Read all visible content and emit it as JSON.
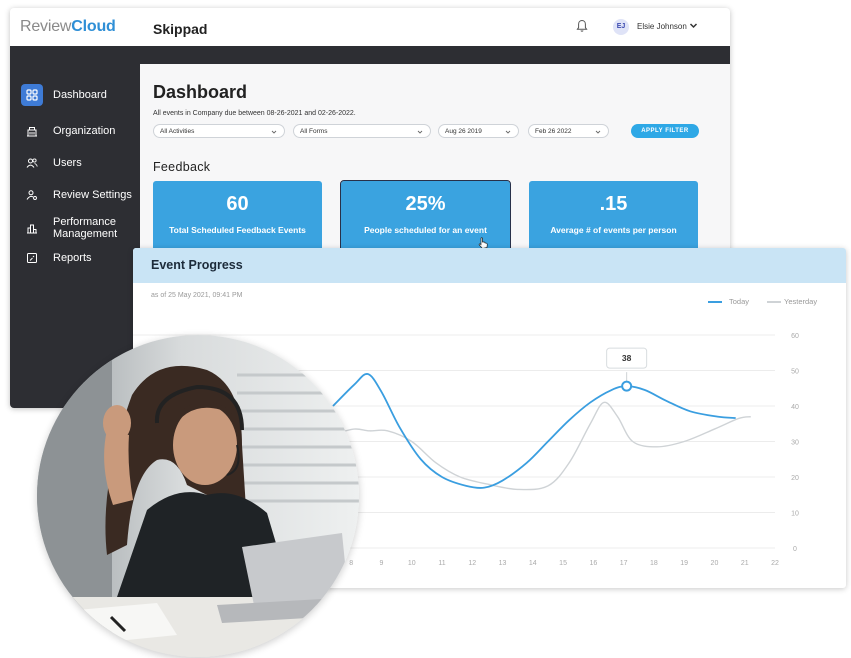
{
  "app": {
    "logo_part1": "Review",
    "logo_part2": "Cloud",
    "title": "Skippad"
  },
  "user": {
    "initials": "EJ",
    "name": "Elsie Johnson"
  },
  "sidebar": {
    "items": [
      {
        "label": "Dashboard",
        "icon": "grid-icon",
        "active": true
      },
      {
        "label": "Organization",
        "icon": "building-icon"
      },
      {
        "label": "Users",
        "icon": "users-icon"
      },
      {
        "label": "Review Settings",
        "icon": "user-settings-icon"
      },
      {
        "label_line1": "Performance",
        "label_line2": "Management",
        "icon": "performance-icon"
      },
      {
        "label": "Reports",
        "icon": "report-icon"
      }
    ]
  },
  "dashboard": {
    "title": "Dashboard",
    "subtitle": "All events in Company due between 08-26-2021 and 02-26-2022.",
    "filters": {
      "activities": "All Activities",
      "forms": "All Forms",
      "date_from": "Aug 26 2019",
      "date_to": "Feb 26 2022",
      "apply_label": "APPLY FILTER"
    },
    "feedback_title": "Feedback",
    "cards": [
      {
        "value": "60",
        "label": "Total Scheduled Feedback Events"
      },
      {
        "value": "25%",
        "label": "People scheduled for an event"
      },
      {
        "value": ".15",
        "label": "Average # of events per person"
      }
    ]
  },
  "event_progress": {
    "title": "Event Progress",
    "as_of": "as of 25 May 2021, 09:41 PM",
    "tooltip": "38"
  },
  "colors": {
    "accent": "#3aa3e0",
    "sidebar": "#2d2e33",
    "today_line": "#3a9ee0",
    "yesterday_line": "#cfd3d6"
  },
  "chart_data": {
    "type": "line",
    "x": [
      8,
      9,
      10,
      11,
      12,
      13,
      14,
      15,
      16,
      17,
      18,
      19,
      20,
      21,
      22
    ],
    "x_tick_labels": [
      "8",
      "9",
      "10",
      "11",
      "12",
      "13",
      "14",
      "15",
      "16",
      "17",
      "18",
      "19",
      "20",
      "21",
      "22"
    ],
    "y_ticks": [
      0,
      10,
      20,
      30,
      40,
      50,
      60
    ],
    "ylim": [
      0,
      60
    ],
    "xlim": [
      7.4,
      22
    ],
    "grid": true,
    "legend_position": "top-right",
    "series": [
      {
        "name": "Today",
        "points": [
          [
            7.4,
            40
          ],
          [
            8.1,
            46
          ],
          [
            8.55,
            49
          ],
          [
            9,
            44
          ],
          [
            9.6,
            34
          ],
          [
            10.3,
            25
          ],
          [
            11,
            20
          ],
          [
            11.8,
            17.5
          ],
          [
            12.4,
            17
          ],
          [
            13,
            19
          ],
          [
            13.8,
            24
          ],
          [
            14.5,
            30
          ],
          [
            15.2,
            36
          ],
          [
            15.9,
            41
          ],
          [
            16.6,
            44.5
          ],
          [
            17.1,
            45.6
          ],
          [
            17.7,
            44.5
          ],
          [
            18.4,
            41.5
          ],
          [
            19.2,
            38.5
          ],
          [
            20.1,
            37
          ],
          [
            20.7,
            36.6
          ]
        ]
      },
      {
        "name": "Yesterday",
        "points": [
          [
            7.4,
            32
          ],
          [
            8.1,
            33.5
          ],
          [
            8.6,
            33
          ],
          [
            9.2,
            33
          ],
          [
            10,
            30
          ],
          [
            10.8,
            24
          ],
          [
            11.6,
            20
          ],
          [
            12.5,
            18
          ],
          [
            13.5,
            16.5
          ],
          [
            14.5,
            17.5
          ],
          [
            15.2,
            24
          ],
          [
            15.9,
            35
          ],
          [
            16.35,
            41
          ],
          [
            16.8,
            37
          ],
          [
            17.3,
            30
          ],
          [
            18.1,
            28.5
          ],
          [
            19,
            30
          ],
          [
            20,
            33.5
          ],
          [
            20.8,
            36.5
          ],
          [
            21.2,
            37
          ]
        ]
      }
    ],
    "highlight": {
      "x": 17.1,
      "y": 45.6,
      "label": "38"
    }
  }
}
